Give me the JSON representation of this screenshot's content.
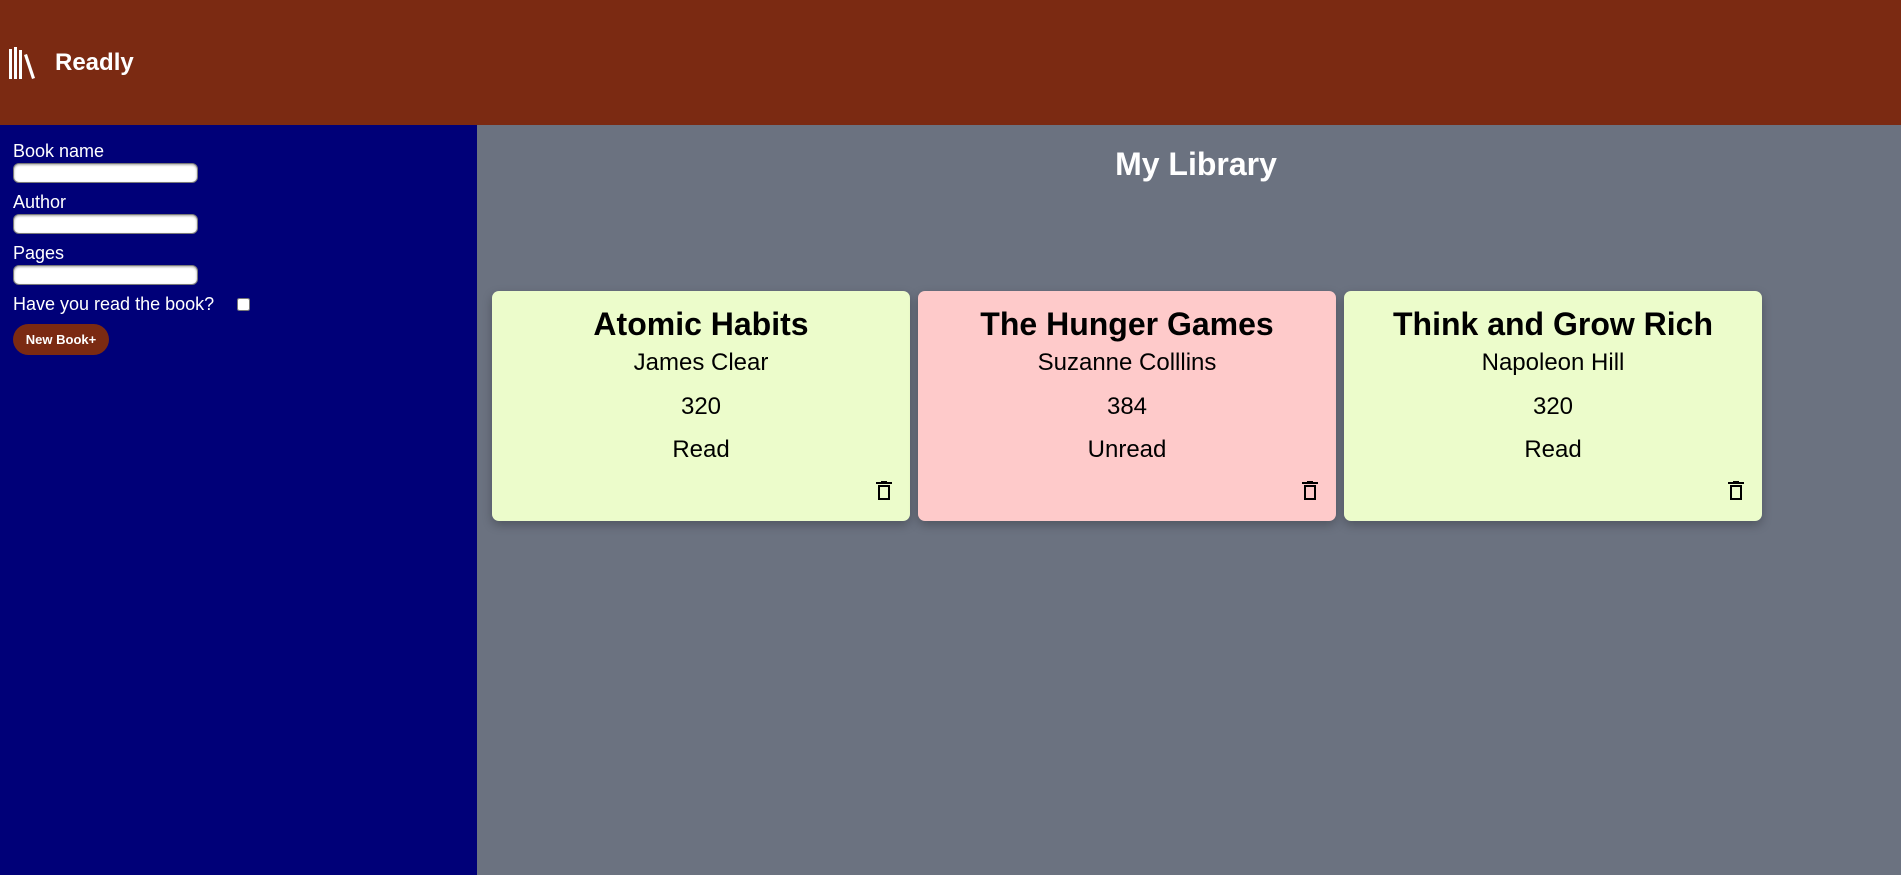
{
  "header": {
    "app_title": "Readly",
    "logo_icon": "books-icon",
    "background_color": "#7b2a12"
  },
  "sidebar": {
    "background_color": "#000078",
    "book_name_label": "Book name",
    "author_label": "Author",
    "pages_label": "Pages",
    "read_checkbox_label": "Have you read the book?",
    "book_name_value": "",
    "author_value": "",
    "pages_value": "",
    "read_checked": false,
    "new_book_button_label": "New Book+"
  },
  "main": {
    "title": "My Library",
    "background_color": "#6b7280",
    "cards": [
      {
        "title": "Atomic Habits",
        "author": "James Clear",
        "pages": "320",
        "status": "Read",
        "card_color": "#ecfccb",
        "delete_icon": "trash-icon"
      },
      {
        "title": "The Hunger Games",
        "author": "Suzanne Colllins",
        "pages": "384",
        "status": "Unread",
        "card_color": "#fecaca",
        "delete_icon": "trash-icon"
      },
      {
        "title": "Think and Grow Rich",
        "author": "Napoleon Hill",
        "pages": "320",
        "status": "Read",
        "card_color": "#ecfccb",
        "delete_icon": "trash-icon"
      }
    ]
  }
}
